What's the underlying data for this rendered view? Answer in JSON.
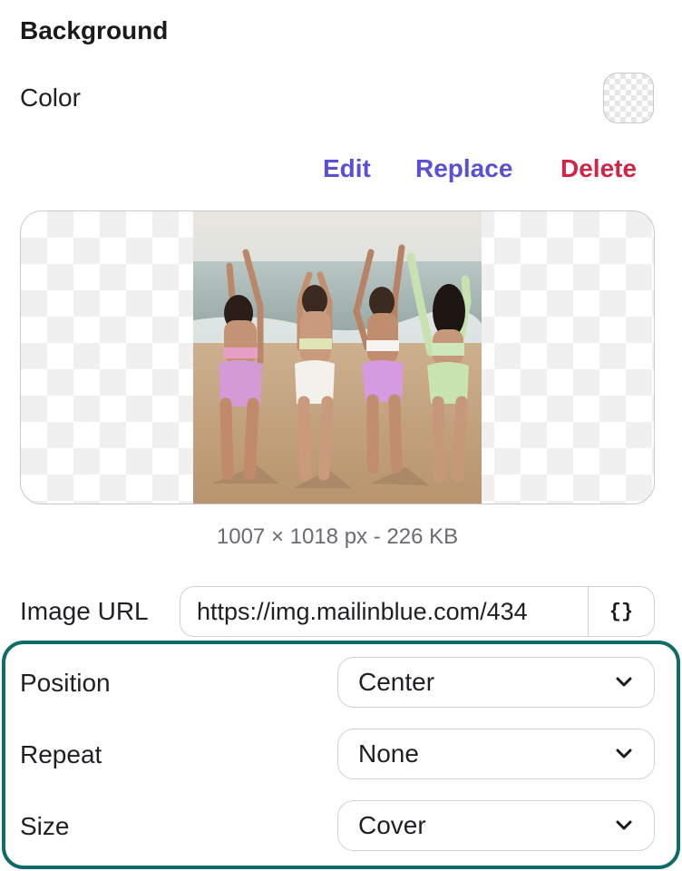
{
  "background": {
    "title": "Background",
    "color_label": "Color",
    "actions": {
      "edit": "Edit",
      "replace": "Replace",
      "delete": "Delete"
    },
    "image_meta": "1007 × 1018 px - 226 KB",
    "image_url": {
      "label": "Image URL",
      "value": "https://img.mailinblue.com/434",
      "variable_button": "{}"
    },
    "position": {
      "label": "Position",
      "value": "Center"
    },
    "repeat": {
      "label": "Repeat",
      "value": "None"
    },
    "size": {
      "label": "Size",
      "value": "Cover"
    }
  },
  "colors": {
    "accent": "#5b4fd6",
    "danger": "#d02549",
    "highlight": "#0f6b68"
  },
  "icons": {
    "swatch": "transparent-checkerboard",
    "variable": "curly-braces-icon",
    "dropdown": "chevron-down-icon"
  }
}
